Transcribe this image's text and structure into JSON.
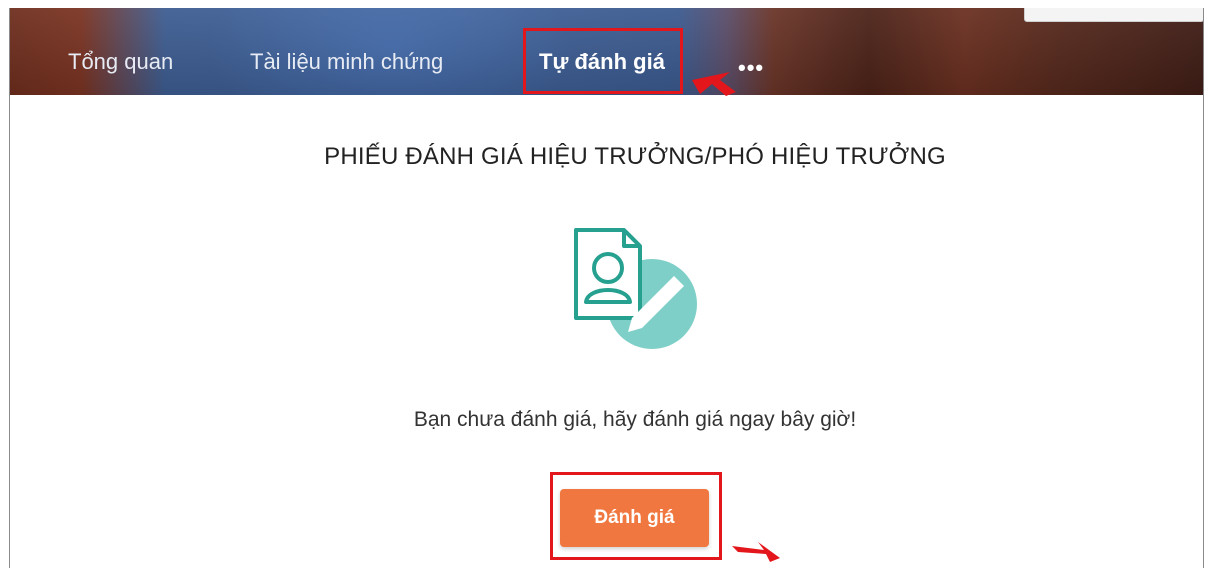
{
  "nav": {
    "tabs": [
      {
        "label": "Tổng quan",
        "active": false
      },
      {
        "label": "Tài liệu minh chứng",
        "active": false
      },
      {
        "label": "Tự đánh giá",
        "active": true
      }
    ],
    "more_label": "•••"
  },
  "main": {
    "title": "PHIẾU ĐÁNH GIÁ HIỆU TRƯỞNG/PHÓ HIỆU TRƯỞNG",
    "illustration_icon": "document-user-check-icon",
    "message": "Bạn chưa đánh giá, hãy đánh giá ngay bây giờ!",
    "button_label": "Đánh giá"
  },
  "colors": {
    "accent_button": "#f0773f",
    "highlight": "#e3161c",
    "icon_teal": "#26a08f"
  }
}
